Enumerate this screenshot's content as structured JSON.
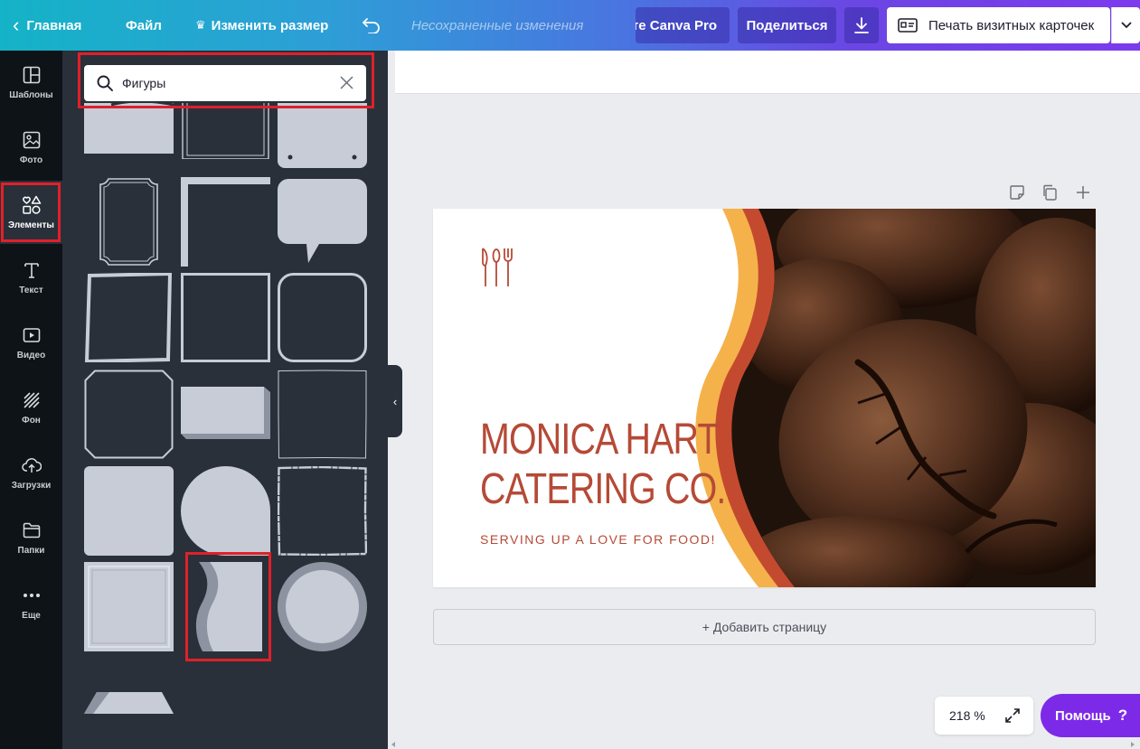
{
  "topbar": {
    "home_label": "Главная",
    "file_label": "Файл",
    "resize_label": "Изменить размер",
    "unsaved_label": "Несохраненные изменения",
    "pro_label": "те Canva Pro",
    "share_label": "Поделиться",
    "print_label": "Печать визитных карточек"
  },
  "sidebar": {
    "items": [
      {
        "label": "Шаблоны",
        "icon": "templates-icon"
      },
      {
        "label": "Фото",
        "icon": "photo-icon"
      },
      {
        "label": "Элементы",
        "icon": "elements-icon",
        "active": true
      },
      {
        "label": "Текст",
        "icon": "text-icon"
      },
      {
        "label": "Видео",
        "icon": "video-icon"
      },
      {
        "label": "Фон",
        "icon": "background-icon"
      },
      {
        "label": "Загрузки",
        "icon": "upload-icon"
      },
      {
        "label": "Папки",
        "icon": "folder-icon"
      },
      {
        "label": "Еще",
        "icon": "more-icon"
      }
    ]
  },
  "panel": {
    "search_value": "Фигуры"
  },
  "card": {
    "name_line1": "MONICA HART",
    "name_line2": "CATERING CO.",
    "tagline": "SERVING UP A LOVE FOR FOOD!"
  },
  "canvas": {
    "add_page_label": "+ Добавить страницу",
    "zoom_label": "218 %"
  },
  "help": {
    "label": "Помощь",
    "icon": "?"
  },
  "colors": {
    "accent_purple": "#7d2ae8",
    "highlight_red": "#e0202a",
    "card_text": "#b54a37",
    "wave_orange": "#f5b24b",
    "wave_red": "#c44a2f",
    "shape_fill": "#c7ccd6",
    "panel_bg": "#293039",
    "rail_bg": "#0e1318"
  }
}
